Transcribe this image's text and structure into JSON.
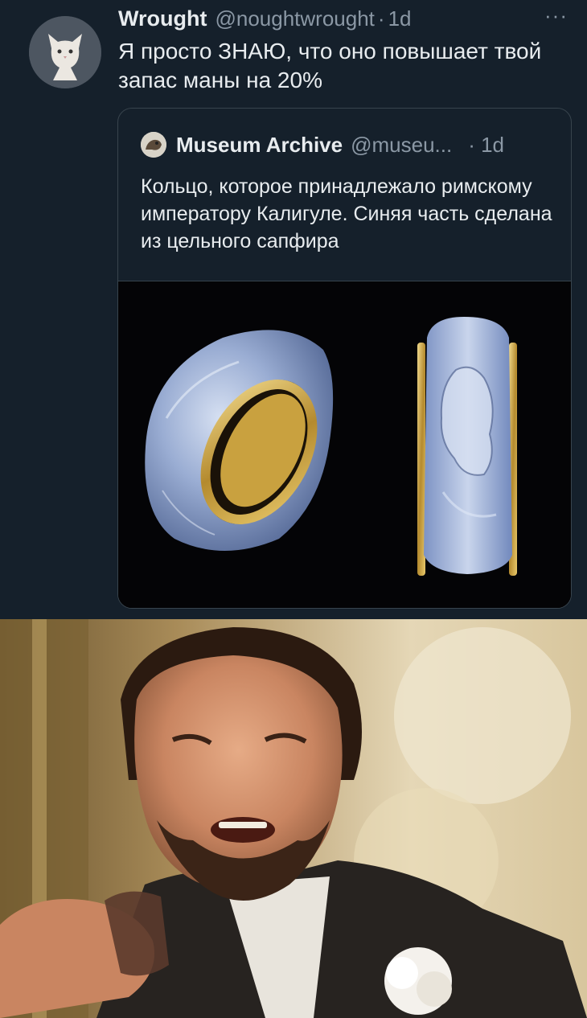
{
  "tweet": {
    "author_name": "Wrought",
    "author_handle": "@noughtwrought",
    "separator": "·",
    "time": "1d",
    "more_label": "···",
    "text": "Я просто ЗНАЮ, что оно повышает твой запас маны на 20%"
  },
  "quoted_tweet": {
    "author_name": "Museum Archive",
    "author_handle": "@museu...",
    "time": "· 1d",
    "text": "Кольцо, которое принадлежало римскому императору Калигуле. Синяя часть сделана из цельного сапфира"
  },
  "colors": {
    "background": "#15202b",
    "text_primary": "#e8ecef",
    "text_secondary": "#8b98a5",
    "border": "#38444d"
  }
}
